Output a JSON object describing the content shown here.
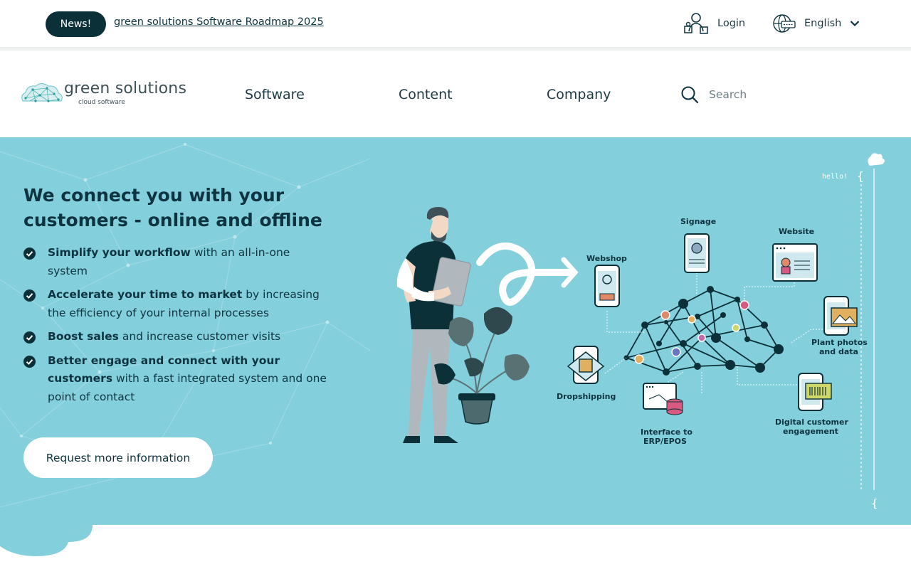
{
  "topbar": {
    "news_badge": "News!",
    "news_link": "green solutions Software Roadmap 2025",
    "login_label": "Login",
    "language_label": "English"
  },
  "logo": {
    "name": "green solutions",
    "tagline": "cloud software"
  },
  "nav": {
    "items": [
      {
        "label": "Software"
      },
      {
        "label": "Content"
      },
      {
        "label": "Company"
      }
    ],
    "search_placeholder": "Search"
  },
  "hero": {
    "headline": "We connect you with your customers - online and offline",
    "bullets": [
      {
        "bold": "Simplify your workflow",
        "rest": " with an all-in-one system"
      },
      {
        "bold": "Accelerate your time to market",
        "rest": " by increasing the efficiency of your internal processes"
      },
      {
        "bold": "Boost sales",
        "rest": " and increase customer visits"
      },
      {
        "bold": "Better engage and connect with your customers",
        "rest": " with a fast integrated system and one point of contact"
      }
    ],
    "cta_label": "Request more information"
  },
  "illustration": {
    "labels": {
      "webshop": "Webshop",
      "signage": "Signage",
      "website": "Website",
      "plant_photos_1": "Plant photos",
      "plant_photos_2": "and data",
      "dropshipping": "Dropshipping",
      "interface_1": "Interface to",
      "interface_2": "ERP/EPOS",
      "digital_1": "Digital customer",
      "digital_2": "engagement",
      "code_hello": "hello!"
    }
  },
  "colors": {
    "hero_bg": "#84cfdc",
    "dark": "#0b3038",
    "white": "#ffffff"
  }
}
